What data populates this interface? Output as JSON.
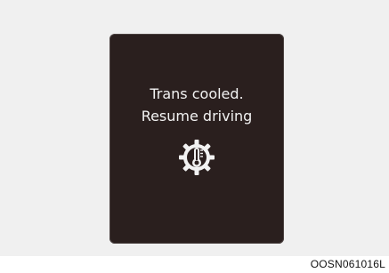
{
  "display": {
    "message_line1": "Trans cooled.",
    "message_line2": "Resume driving",
    "icon": "transmission-temperature-gear-icon",
    "background_color": "#2a1f1e",
    "text_color": "#f2f2f2"
  },
  "caption": "OOSN061016L"
}
